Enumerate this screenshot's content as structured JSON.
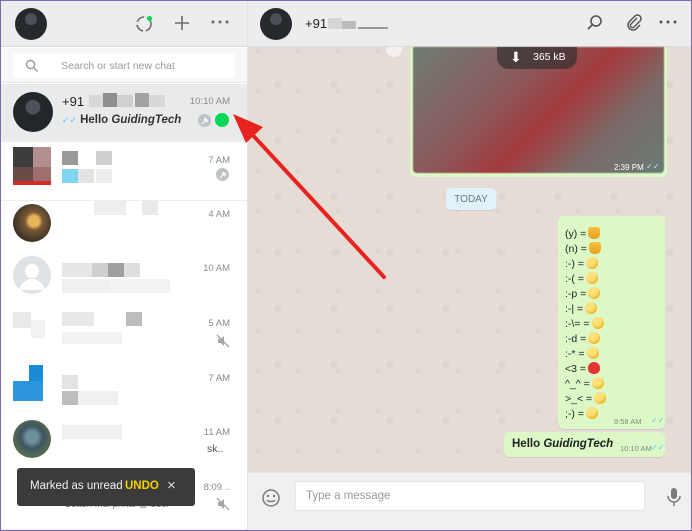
{
  "left": {
    "search": {
      "placeholder": "Search or start new chat"
    },
    "chats": [
      {
        "name": "+91",
        "time": "10:10 AM",
        "preview_bold": "Hello ",
        "preview_italic": "GuidingTech",
        "selected": true
      },
      {
        "time": "7 AM"
      },
      {
        "time": "4 AM"
      },
      {
        "time": "10 AM"
      },
      {
        "time": "5 AM"
      },
      {
        "time": "7 AM"
      },
      {
        "time": "11 AM",
        "preview_fragment": "sk.."
      },
      {
        "time": "8:09 ..",
        "preview_fragment": "Cotton Mul prints @ 350/-"
      }
    ]
  },
  "toast": {
    "text": "Marked as unread",
    "undo": "UNDO",
    "close": "×"
  },
  "right": {
    "header": {
      "contact_name": "+91"
    },
    "image_message": {
      "size": "365 kB",
      "time": "2:39 PM"
    },
    "date_chip": "TODAY",
    "emoji_message": {
      "lines": [
        "(y) =",
        "(n) =",
        ":-) =",
        ":-( =",
        ":-p =",
        ":-| =",
        ":-\\= =",
        ":-d =",
        ":-* =",
        "<3 =",
        "^_^ =",
        ">_< =",
        ";-) ="
      ],
      "time": "9:58 AM"
    },
    "text_message": {
      "bold": "Hello ",
      "italic": "GuidingTech",
      "time": "10:10 AM"
    },
    "compose": {
      "placeholder": "Type a message"
    }
  },
  "icons": {
    "ticks": "✓✓",
    "colors": {
      "accent_green": "#06d755",
      "bubble": "#dcf8c6",
      "undo": "#f5d000",
      "arrow": "#e8231f",
      "ticks": "#4fc3f7"
    }
  }
}
